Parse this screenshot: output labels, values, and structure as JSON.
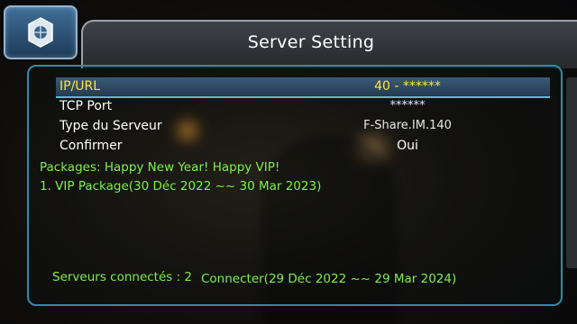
{
  "header": {
    "title": "Server Setting"
  },
  "settings": [
    {
      "label": "IP/URL",
      "value": "40 - ******",
      "selected": true
    },
    {
      "label": "TCP Port",
      "value": "******"
    },
    {
      "label": "Type du Serveur",
      "value": "F-Share.IM.140"
    },
    {
      "label": "Confirmer",
      "value": "Oui"
    }
  ],
  "packages": {
    "header": "Packages: Happy New Year! Happy VIP!",
    "items": [
      "1. VIP Package(30 Déc 2022 ~~ 30 Mar 2023)"
    ]
  },
  "footer": {
    "servers_connected": "Serveurs connectés : 2",
    "connecter": "Connecter(29 Déc 2022 ~~ 29 Mar 2024)"
  },
  "colors": {
    "selected_text": "#ffe23a",
    "info_green": "#7df04a",
    "frame": "#2a8fa6"
  }
}
